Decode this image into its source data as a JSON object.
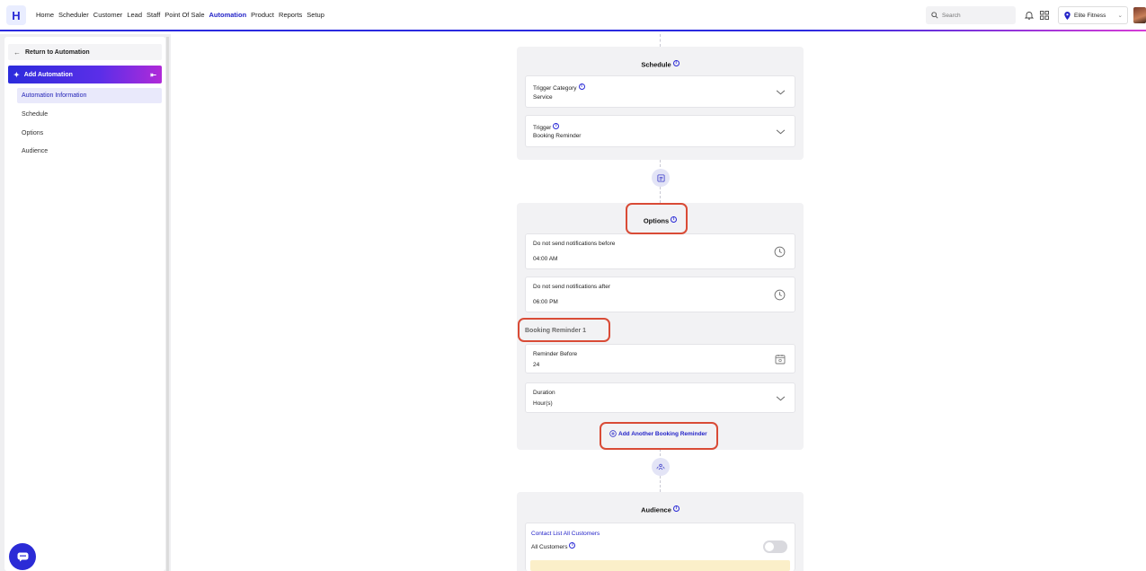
{
  "app": {
    "logo_letter": "H"
  },
  "nav": {
    "items": [
      "Home",
      "Scheduler",
      "Customer",
      "Lead",
      "Staff",
      "Point Of Sale",
      "Automation",
      "Product",
      "Reports",
      "Setup"
    ],
    "active": "Automation"
  },
  "search": {
    "placeholder": "Search"
  },
  "location": {
    "name": "Elite Fitness"
  },
  "sidebar": {
    "return_label": "Return to Automation",
    "header_label": "Add Automation",
    "items": [
      "Automation Information",
      "Schedule",
      "Options",
      "Audience"
    ]
  },
  "schedule": {
    "title": "Schedule",
    "trigger_category_label": "Trigger Category",
    "trigger_category_value": "Service",
    "trigger_label": "Trigger",
    "trigger_value": "Booking Reminder"
  },
  "options": {
    "title": "Options",
    "before_label": "Do not send notifications before",
    "before_value": "04:00 AM",
    "after_label": "Do not send notifications after",
    "after_value": "06:00 PM",
    "reminder_section": "Booking Reminder 1",
    "reminder_before_label": "Reminder Before",
    "reminder_before_value": "24",
    "duration_label": "Duration",
    "duration_value": "Hour(s)",
    "add_reminder": "Add Another Booking Reminder"
  },
  "audience": {
    "title": "Audience",
    "contact_list": "Contact List All Customers",
    "all_customers_label": "All Customers",
    "all_customers_enabled": false
  },
  "colors": {
    "accent": "#2424c8",
    "highlight": "#d94b36"
  }
}
